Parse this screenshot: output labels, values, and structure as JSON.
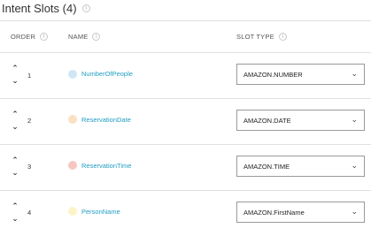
{
  "section": {
    "title": "Intent Slots (4)",
    "info_icon": "info-circle-icon"
  },
  "columns": {
    "order": "ORDER",
    "name": "NAME",
    "slot_type": "SLOT TYPE"
  },
  "colors": {
    "slot_link": "#1f9cc4",
    "border": "#e0e0e0"
  },
  "slots": [
    {
      "order": "1",
      "name": "NumberOfPeople",
      "type": "AMAZON.NUMBER",
      "color": "#cfe6f7"
    },
    {
      "order": "2",
      "name": "ReservationDate",
      "type": "AMAZON.DATE",
      "color": "#fbe1c4"
    },
    {
      "order": "3",
      "name": "ReservationTime",
      "type": "AMAZON.TIME",
      "color": "#f6c7c0"
    },
    {
      "order": "4",
      "name": "PersonName",
      "type": "AMAZON.FirstName",
      "color": "#fcf4c8"
    }
  ]
}
